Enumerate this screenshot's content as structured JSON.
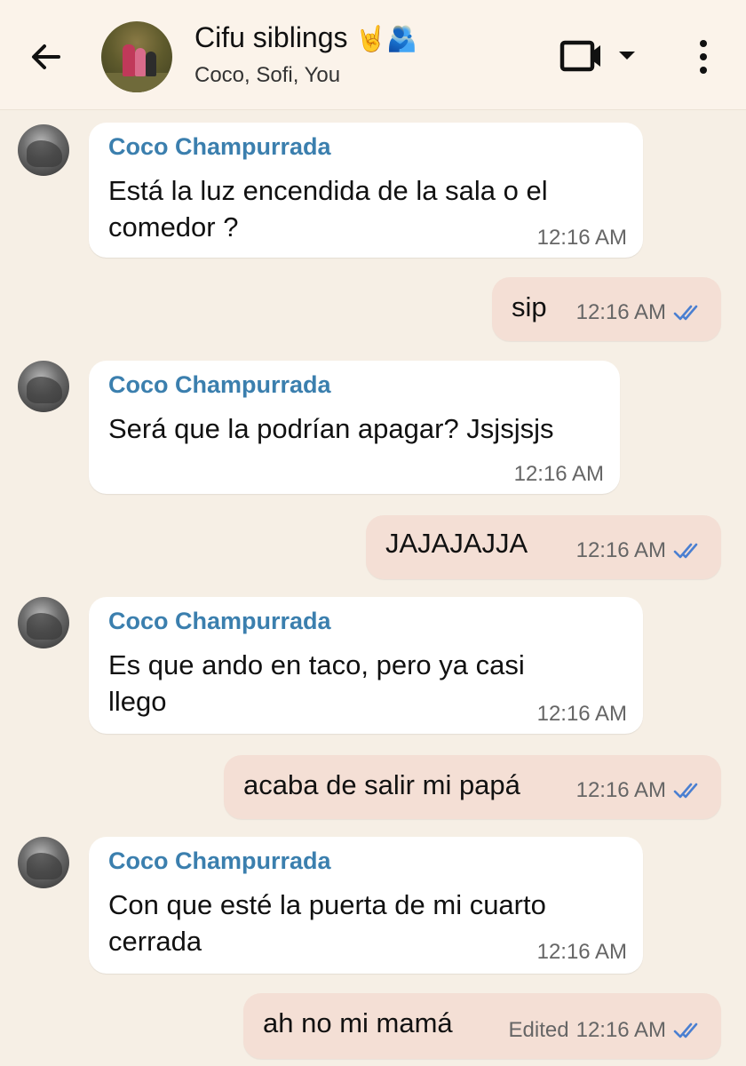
{
  "header": {
    "title": "Cifu siblings",
    "title_emoji": "🤘🫂",
    "subtitle": "Coco, Sofi, You",
    "icons": [
      "back-arrow-icon",
      "group-avatar",
      "video-call-icon",
      "dropdown-icon",
      "more-options-icon"
    ]
  },
  "colors": {
    "background": "#f6efe5",
    "incoming_bubble": "#ffffff",
    "outgoing_bubble": "#f4dfd5",
    "sender_name": "#3b7fae",
    "read_ticks": "#4a7fd1"
  },
  "messages": [
    {
      "direction": "in",
      "sender": "Coco Champurrada",
      "lines": [
        "Está la luz encendida de la sala o el",
        "comedor ?"
      ],
      "time": "12:16 AM"
    },
    {
      "direction": "out",
      "text": "sip",
      "time": "12:16 AM",
      "status": "read"
    },
    {
      "direction": "in",
      "sender": "Coco Champurrada",
      "lines": [
        "Será que la podrían apagar? Jsjsjsjs"
      ],
      "time": "12:16 AM"
    },
    {
      "direction": "out",
      "text": "JAJAJAJJA",
      "time": "12:16 AM",
      "status": "read"
    },
    {
      "direction": "in",
      "sender": "Coco Champurrada",
      "lines": [
        "Es que ando en taco, pero ya casi",
        "llego"
      ],
      "time": "12:16 AM"
    },
    {
      "direction": "out",
      "text": "acaba de salir mi papá",
      "time": "12:16 AM",
      "status": "read"
    },
    {
      "direction": "in",
      "sender": "Coco Champurrada",
      "lines": [
        "Con que esté la puerta de mi cuarto",
        "cerrada"
      ],
      "time": "12:16 AM"
    },
    {
      "direction": "out",
      "text": "ah no mi mamá",
      "edited": "Edited",
      "time": "12:16 AM",
      "status": "read"
    }
  ]
}
